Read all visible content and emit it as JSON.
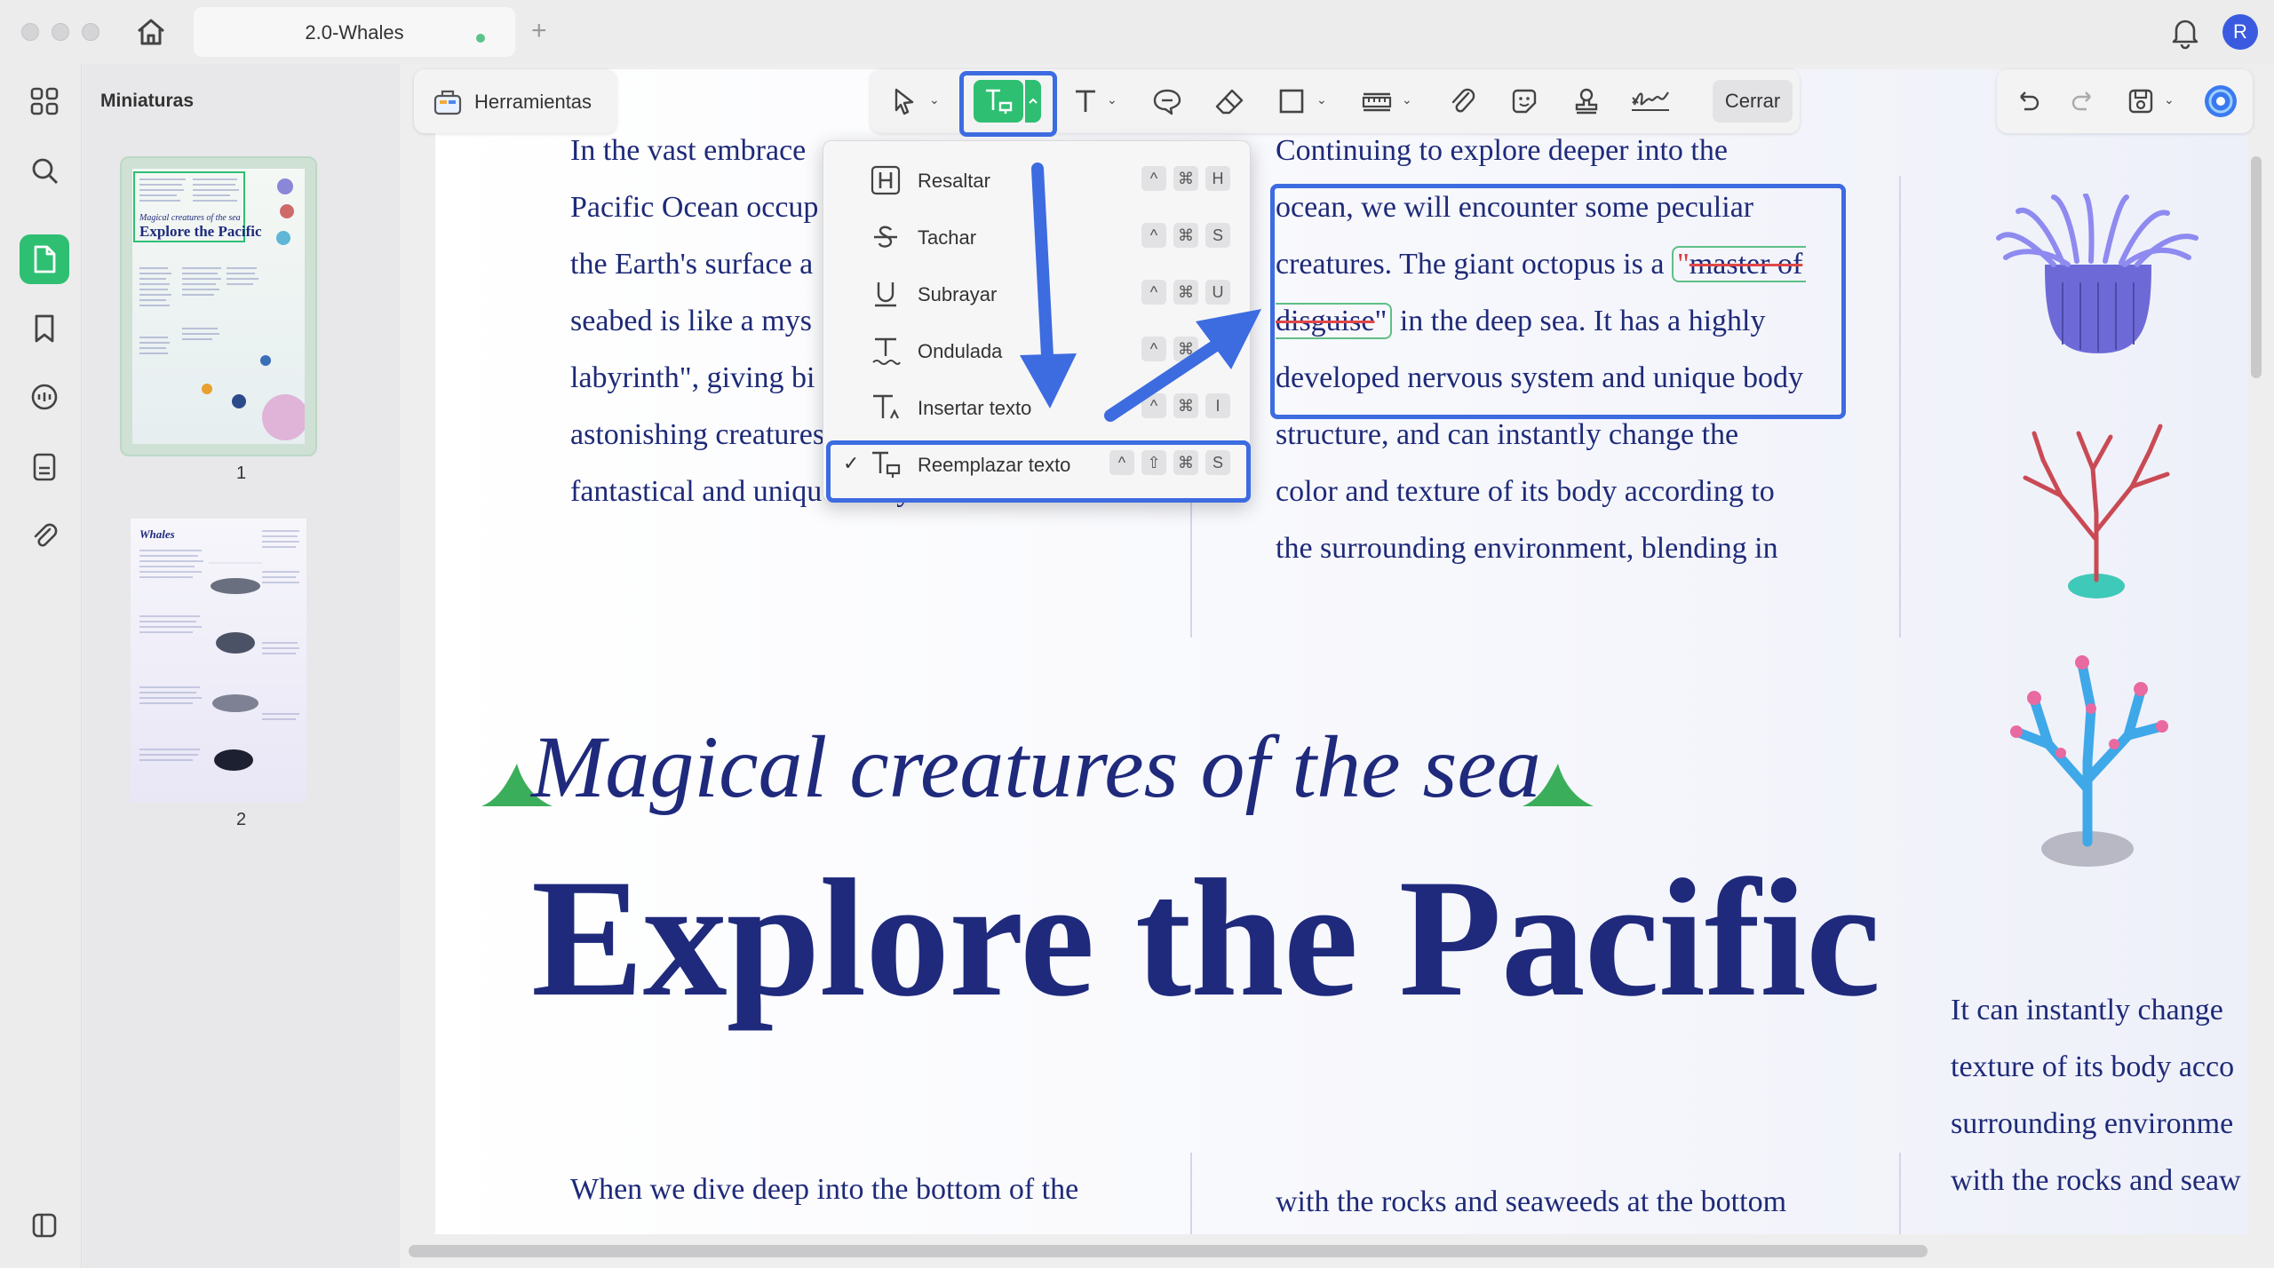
{
  "window": {
    "tab_title": "2.0-Whales",
    "avatar_initial": "R"
  },
  "sidebar": {
    "panel_title": "Miniaturas",
    "icons": [
      "grid-icon",
      "search-icon",
      "pages-icon",
      "bookmark-icon",
      "comment-icon",
      "forms-icon",
      "attachment-icon",
      "collapse-icon"
    ]
  },
  "thumbnails": [
    {
      "page": "1",
      "mini_title": "Explore the Pacific",
      "mini_subtitle": "Magical creatures of the sea"
    },
    {
      "page": "2",
      "mini_title": "Whales"
    }
  ],
  "toolbar": {
    "tools_label": "Herramientas",
    "close_label": "Cerrar",
    "icons": [
      "select-cursor-icon",
      "replace-text-icon",
      "text-icon",
      "comment-icon",
      "eraser-icon",
      "rectangle-icon",
      "measure-icon",
      "paperclip-icon",
      "sticker-icon",
      "stamp-icon",
      "signature-icon",
      "undo-icon",
      "redo-icon",
      "save-icon",
      "ai-assistant-icon"
    ]
  },
  "markup_menu": {
    "items": [
      {
        "label": "Resaltar",
        "keys": [
          "^",
          "⌘",
          "H"
        ],
        "checked": false
      },
      {
        "label": "Tachar",
        "keys": [
          "^",
          "⌘",
          "S"
        ],
        "checked": false
      },
      {
        "label": "Subrayar",
        "keys": [
          "^",
          "⌘",
          "U"
        ],
        "checked": false
      },
      {
        "label": "Ondulada",
        "keys": [
          "^",
          "⌘",
          ""
        ],
        "checked": false
      },
      {
        "label": "Insertar texto",
        "keys": [
          "^",
          "⌘",
          "I"
        ],
        "checked": false
      },
      {
        "label": "Reemplazar texto",
        "keys": [
          "^",
          "⇧",
          "⌘",
          "S"
        ],
        "checked": true
      }
    ],
    "check_mark": "✓"
  },
  "document": {
    "col1_lines": [
      "In the vast embrace",
      "Pacific Ocean occup",
      "the Earth's surface a",
      "seabed is like a mys",
      "labyrinth\", giving bi",
      "astonishing creatures and constituting a",
      "fantastical and unique ecosystem."
    ],
    "col2_lines": [
      "Continuing to explore deeper into the",
      "ocean, we will encounter some peculiar",
      "creatures. The giant octopus is a ",
      "developed nervous system and unique body",
      "structure, and can instantly change the",
      "color and texture of its body according to",
      "the surrounding environment, blending in"
    ],
    "col2_line4_after": " in the deep sea. It has a highly",
    "strike_part1": "master of",
    "strike_part2": "disguise",
    "quote_open": "\"",
    "quote_close": "\"",
    "script_title": "Magical creatures of the sea.",
    "big_title": "Explore the Pacific",
    "right_col_lines": [
      "It can instantly change",
      "texture of its body acco",
      "surrounding environme",
      "with the rocks and seaw"
    ],
    "bottom_col1": "When we dive deep into the bottom of the",
    "bottom_col2": "with the rocks and seaweeds at the bottom"
  },
  "colors": {
    "accent_green": "#2fbf73",
    "highlight_blue": "#3d6be0",
    "text_navy": "#1f2a7c",
    "strike_red": "#e04848"
  }
}
